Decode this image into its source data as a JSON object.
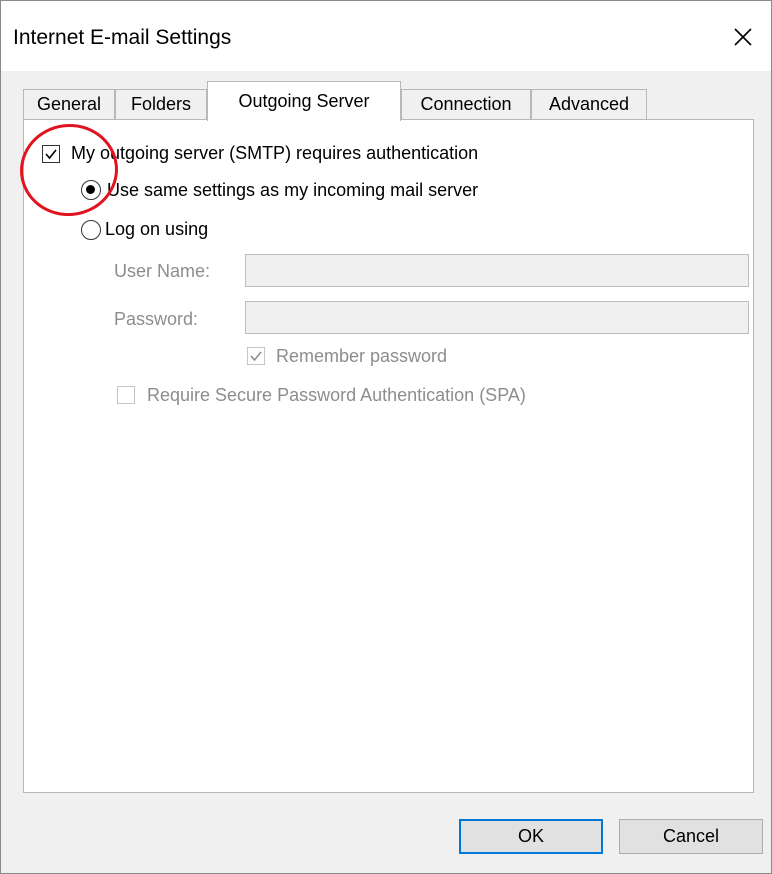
{
  "window": {
    "title": "Internet E-mail Settings"
  },
  "tabs": [
    {
      "label": "General",
      "active": false
    },
    {
      "label": "Folders",
      "active": false
    },
    {
      "label": "Outgoing Server",
      "active": true
    },
    {
      "label": "Connection",
      "active": false
    },
    {
      "label": "Advanced",
      "active": false
    }
  ],
  "outgoing": {
    "requires_auth": {
      "label": "My outgoing server (SMTP) requires authentication",
      "checked": true
    },
    "use_same": {
      "label": "Use same settings as my incoming mail server",
      "selected": true
    },
    "log_on": {
      "label": "Log on using",
      "selected": false
    },
    "user_name": {
      "label": "User Name:",
      "value": ""
    },
    "password": {
      "label": "Password:",
      "value": ""
    },
    "remember_password": {
      "label": "Remember password",
      "checked": true,
      "enabled": false
    },
    "spa": {
      "label": "Require Secure Password Authentication (SPA)",
      "checked": false,
      "enabled": false
    }
  },
  "buttons": {
    "ok": "OK",
    "cancel": "Cancel"
  },
  "colors": {
    "annotation": "#e0141e",
    "default_button_border": "#0078d7"
  }
}
